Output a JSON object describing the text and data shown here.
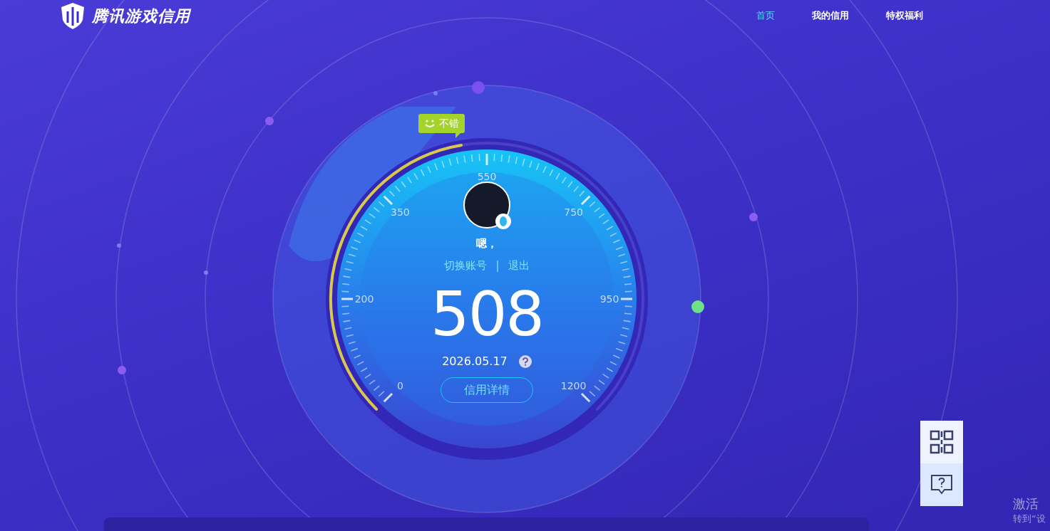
{
  "header": {
    "logo_text": "腾讯游戏信用"
  },
  "nav": [
    {
      "label": "首页",
      "selected": true
    },
    {
      "label": "我的信用",
      "selected": false
    },
    {
      "label": "特权福利",
      "selected": false
    }
  ],
  "mood_badge": {
    "label": "不错"
  },
  "gauge": {
    "ticks": [
      "0",
      "200",
      "350",
      "550",
      "750",
      "950",
      "1200"
    ],
    "level": 0.465
  },
  "user": {
    "nickname": "嗯，",
    "links": [
      "切换账号",
      "退出"
    ],
    "separator": "|"
  },
  "score": "508",
  "date": "2026.05.17",
  "detail_button": "信用详情",
  "side_buttons": [
    {
      "kind": "qrcode"
    },
    {
      "kind": "help"
    }
  ],
  "system_overlay": {
    "title": "激活",
    "subtitle": "转到“设"
  }
}
